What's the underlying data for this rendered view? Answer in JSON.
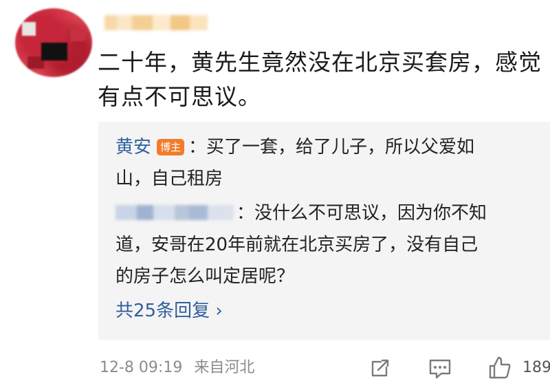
{
  "comment": {
    "text": "二十年，黄先生竟然没在北京买套房，感觉有点不可思议。"
  },
  "replies": [
    {
      "author": "黄安",
      "badge": "博主",
      "text_line1": "：买了一套，给了儿子，所以父爱如",
      "text_line2": "山，自己租房"
    },
    {
      "text_line1": "：没什么不可思议，因为你不知",
      "text_line2": "道，安哥在20年前就在北京买房了，没有自己",
      "text_line3": "的房子怎么叫定居呢？"
    }
  ],
  "more_replies": "共25条回复 ›",
  "footer": {
    "timestamp": "12-8 09:19",
    "location": "来自河北",
    "like_count": "189"
  },
  "icons": [
    "share-icon",
    "comment-icon",
    "like-icon"
  ]
}
